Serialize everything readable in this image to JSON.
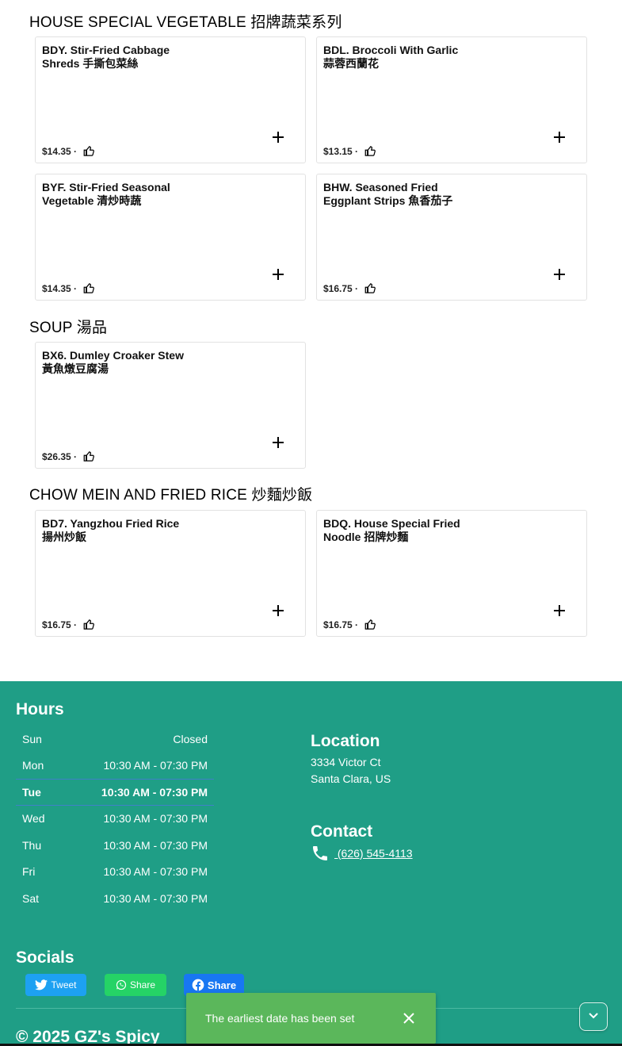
{
  "sections": {
    "vegetable": "HOUSE SPECIAL VEGETABLE 招牌蔬菜系列",
    "soup": "SOUP 湯品",
    "chowmein": "CHOW MEIN AND FRIED RICE 炒麵炒飯"
  },
  "items": [
    {
      "name": "BDY. Stir-Fried Cabbage Shreds 手撕包菜絲",
      "price": "$14.35 ·"
    },
    {
      "name": "BDL. Broccoli With Garlic 蒜蓉西蘭花",
      "price": "$13.15 ·"
    },
    {
      "name": "BYF. Stir-Fried Seasonal Vegetable 清炒時蔬",
      "price": "$14.35 ·"
    },
    {
      "name": "BHW. Seasoned Fried Eggplant Strips 魚香茄子",
      "price": "$16.75 ·"
    },
    {
      "name": "BX6. Dumley Croaker Stew 黃魚燉豆腐湯",
      "price": "$26.35 ·"
    },
    {
      "name": "BD7. Yangzhou Fried Rice 揚州炒飯",
      "price": "$16.75 ·"
    },
    {
      "name": "BDQ. House Special Fried Noodle 招牌炒麵",
      "price": "$16.75 ·"
    }
  ],
  "footer": {
    "hours_title": "Hours",
    "hours": [
      {
        "day": "Sun",
        "time": "Closed"
      },
      {
        "day": "Mon",
        "time": "10:30 AM - 07:30 PM"
      },
      {
        "day": "Tue",
        "time": "10:30 AM - 07:30 PM"
      },
      {
        "day": "Wed",
        "time": "10:30 AM - 07:30 PM"
      },
      {
        "day": "Thu",
        "time": "10:30 AM - 07:30 PM"
      },
      {
        "day": "Fri",
        "time": "10:30 AM - 07:30 PM"
      },
      {
        "day": "Sat",
        "time": "10:30 AM - 07:30 PM"
      }
    ],
    "location_title": "Location",
    "address_line1": "3334 Victor Ct",
    "address_line2": "Santa Clara, US",
    "contact_title": "Contact",
    "phone": " (626) 545-4113",
    "socials_title": "Socials",
    "tweet_label": "Tweet",
    "whatsapp_label": "Share",
    "facebook_label": "Share",
    "copyright": "© 2025 GZ's Spicy"
  },
  "snackbar": {
    "message": "The earliest date has been set"
  },
  "colors": {
    "footer_bg": "#1f9e86",
    "snackbar_bg": "#5bb75b",
    "twitter": "#1da1f2",
    "whatsapp": "#25d366",
    "facebook": "#1877f2",
    "today_border": "#3f80c8"
  },
  "icons": {
    "add": "plus-icon",
    "like": "thumb-up-icon",
    "phone": "phone-icon",
    "close": "close-icon",
    "scroll": "chevron-down-icon"
  }
}
